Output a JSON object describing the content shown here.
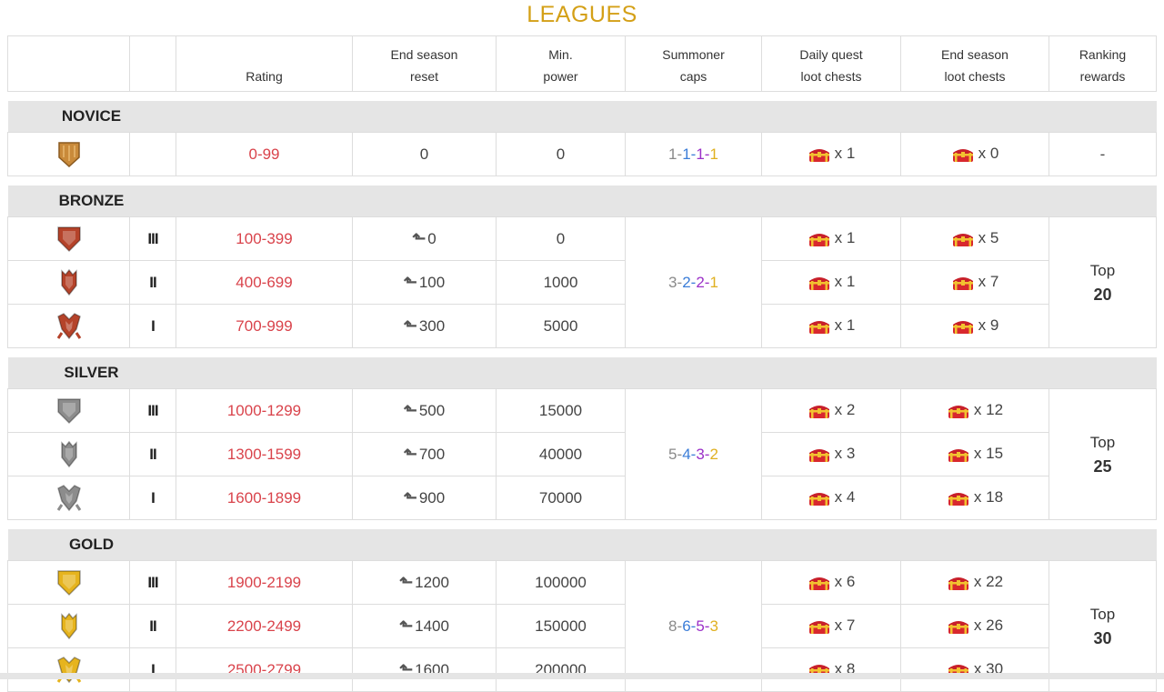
{
  "title": "LEAGUES",
  "headers": {
    "rating": "Rating",
    "reset_1": "End season",
    "reset_2": "reset",
    "power_1": "Min.",
    "power_2": "power",
    "caps_1": "Summoner",
    "caps_2": "caps",
    "daily_1": "Daily quest",
    "daily_2": "loot chests",
    "endloot_1": "End season",
    "endloot_2": "loot chests",
    "rank_1": "Ranking",
    "rank_2": "rewards"
  },
  "colors": {
    "title": "#d4a017",
    "rating": "#d9434b",
    "novice": "#c98a3a",
    "bronze": "#b5432a",
    "silver": "#8c8c8c",
    "gold": "#e6b41e"
  },
  "novice": {
    "name": "NOVICE",
    "badge_icon": "novice-badge-icon",
    "rating": "0-99",
    "reset": "0",
    "power": "0",
    "caps": [
      "1",
      "1",
      "1",
      "1"
    ],
    "daily": "x 1",
    "end": "x 0",
    "rank": "-"
  },
  "bronze": {
    "name": "BRONZE",
    "caps": [
      "3",
      "2",
      "2",
      "1"
    ],
    "rank_top": "Top",
    "rank_num": "20",
    "rows": [
      {
        "tier": "III",
        "rating": "100-399",
        "reset": "0",
        "power": "0",
        "daily": "x 1",
        "end": "x 5"
      },
      {
        "tier": "II",
        "rating": "400-699",
        "reset": "100",
        "power": "1000",
        "daily": "x 1",
        "end": "x 7"
      },
      {
        "tier": "I",
        "rating": "700-999",
        "reset": "300",
        "power": "5000",
        "daily": "x 1",
        "end": "x 9"
      }
    ]
  },
  "silver": {
    "name": "SILVER",
    "caps": [
      "5",
      "4",
      "3",
      "2"
    ],
    "rank_top": "Top",
    "rank_num": "25",
    "rows": [
      {
        "tier": "III",
        "rating": "1000-1299",
        "reset": "500",
        "power": "15000",
        "daily": "x 2",
        "end": "x 12"
      },
      {
        "tier": "II",
        "rating": "1300-1599",
        "reset": "700",
        "power": "40000",
        "daily": "x 3",
        "end": "x 15"
      },
      {
        "tier": "I",
        "rating": "1600-1899",
        "reset": "900",
        "power": "70000",
        "daily": "x 4",
        "end": "x 18"
      }
    ]
  },
  "gold": {
    "name": "GOLD",
    "caps": [
      "8",
      "6",
      "5",
      "3"
    ],
    "rank_top": "Top",
    "rank_num": "30",
    "rows": [
      {
        "tier": "III",
        "rating": "1900-2199",
        "reset": "1200",
        "power": "100000",
        "daily": "x 6",
        "end": "x 22"
      },
      {
        "tier": "II",
        "rating": "2200-2499",
        "reset": "1400",
        "power": "150000",
        "daily": "x 7",
        "end": "x 26"
      },
      {
        "tier": "I",
        "rating": "2500-2799",
        "reset": "1600",
        "power": "200000",
        "daily": "x 8",
        "end": "x 30"
      }
    ]
  }
}
